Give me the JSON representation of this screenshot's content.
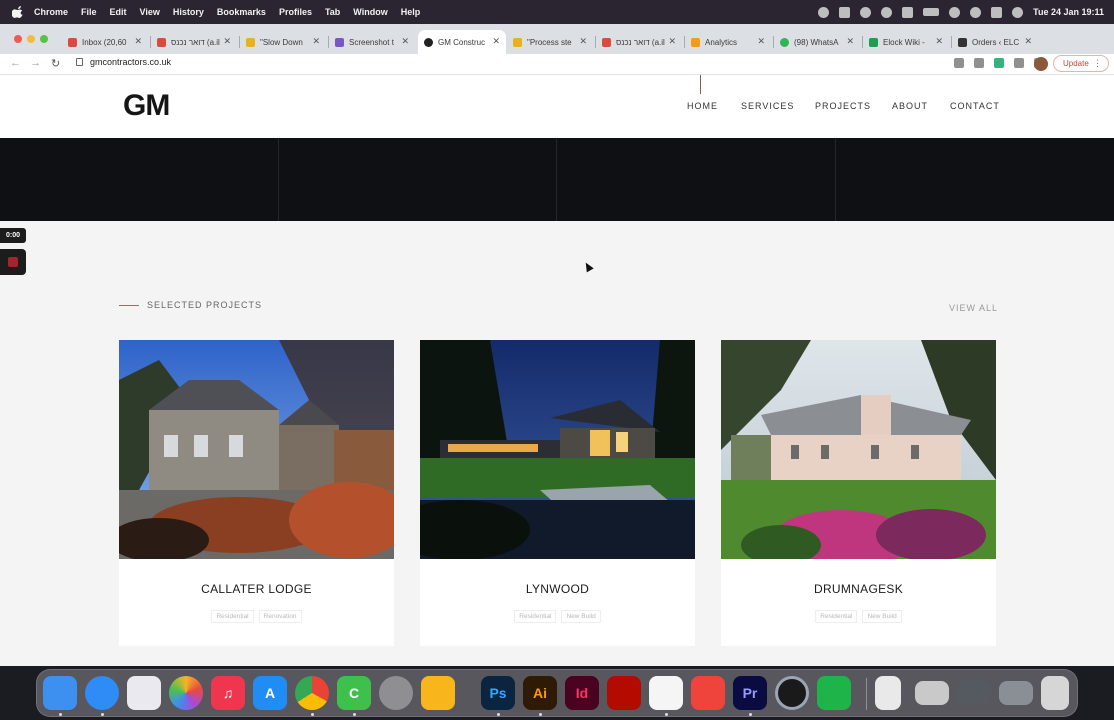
{
  "menubar": {
    "app_name": "Chrome",
    "items": [
      "File",
      "Edit",
      "View",
      "History",
      "Bookmarks",
      "Profiles",
      "Tab",
      "Window",
      "Help"
    ],
    "clock": "Tue 24 Jan  19:11"
  },
  "tabs": [
    {
      "label": "Inbox (20,60",
      "favicon": "gmail-icon",
      "active": false
    },
    {
      "label": "דואר נכנס (a.il",
      "favicon": "gmail-icon",
      "active": false
    },
    {
      "label": "\"Slow Down",
      "favicon": "home-icon",
      "active": false
    },
    {
      "label": "Screenshot t",
      "favicon": "pen-icon",
      "active": false
    },
    {
      "label": "GM Construc",
      "favicon": "gm-icon",
      "active": true
    },
    {
      "label": "\"Process ste",
      "favicon": "home-icon",
      "active": false
    },
    {
      "label": "דואר נכנס (a.il",
      "favicon": "gmail-icon",
      "active": false
    },
    {
      "label": "Analytics",
      "favicon": "analytics-icon",
      "active": false
    },
    {
      "label": "(98) WhatsA",
      "favicon": "whatsapp-icon",
      "active": false
    },
    {
      "label": "Elock Wiki -",
      "favicon": "sheets-icon",
      "active": false
    },
    {
      "label": "Orders ‹ ELC",
      "favicon": "store-icon",
      "active": false
    }
  ],
  "address_bar": {
    "url": "gmcontractors.co.uk",
    "update_label": "Update"
  },
  "site": {
    "logo_text": "GM",
    "nav": [
      "HOME",
      "SERVICES",
      "PROJECTS",
      "ABOUT",
      "CONTACT"
    ],
    "section_title": "SELECTED PROJECTS",
    "view_all": "VIEW ALL",
    "projects": [
      {
        "title": "CALLATER LODGE",
        "tags": [
          "Residential",
          "Renovation"
        ]
      },
      {
        "title": "LYNWOOD",
        "tags": [
          "Residential",
          "New Build"
        ]
      },
      {
        "title": "DRUMNAGESK",
        "tags": [
          "Residential",
          "New Build"
        ]
      }
    ]
  },
  "recorder": {
    "timer": "0:00"
  },
  "dock": [
    {
      "name": "finder-icon",
      "color": "#3d8ff0"
    },
    {
      "name": "safari-icon",
      "color": "#2f8bf5"
    },
    {
      "name": "launchpad-icon",
      "color": "#e9e9ef"
    },
    {
      "name": "photos-icon",
      "color": "#f4f4f4"
    },
    {
      "name": "music-icon",
      "color": "#f0364f"
    },
    {
      "name": "app-store-icon",
      "color": "#1f8df4"
    },
    {
      "name": "chrome-icon",
      "color": "#f2f2f2"
    },
    {
      "name": "camtasia-icon",
      "color": "#3fbf4b"
    },
    {
      "name": "system-settings-icon",
      "color": "#8e8e93"
    },
    {
      "name": "sketch-icon",
      "color": "#f8b51c"
    },
    {
      "name": "photoshop-icon",
      "color": "#0b2540",
      "text": "Ps",
      "text_color": "#31a8ff"
    },
    {
      "name": "illustrator-icon",
      "color": "#2e1a05",
      "text": "Ai",
      "text_color": "#ff9a00"
    },
    {
      "name": "indesign-icon",
      "color": "#49021f",
      "text": "Id",
      "text_color": "#ff3366"
    },
    {
      "name": "acrobat-icon",
      "color": "#b30b00"
    },
    {
      "name": "textedit-icon",
      "color": "#f5f5f5"
    },
    {
      "name": "anydesk-icon",
      "color": "#ef443b"
    },
    {
      "name": "premiere-icon",
      "color": "#0a0b40",
      "text": "Pr",
      "text_color": "#9999ff"
    },
    {
      "name": "quicktime-icon",
      "color": "#1a1a1a"
    },
    {
      "name": "numbers-icon",
      "color": "#1fb44a"
    },
    {
      "name": "document-icon",
      "color": "#e9e9e9"
    },
    {
      "name": "window-preview-icon",
      "color": "#c9c9c9"
    },
    {
      "name": "window-preview-icon",
      "color": "#555a60"
    },
    {
      "name": "window-preview-icon",
      "color": "#8a8f96"
    },
    {
      "name": "trash-icon",
      "color": "#d6d6d6"
    }
  ]
}
